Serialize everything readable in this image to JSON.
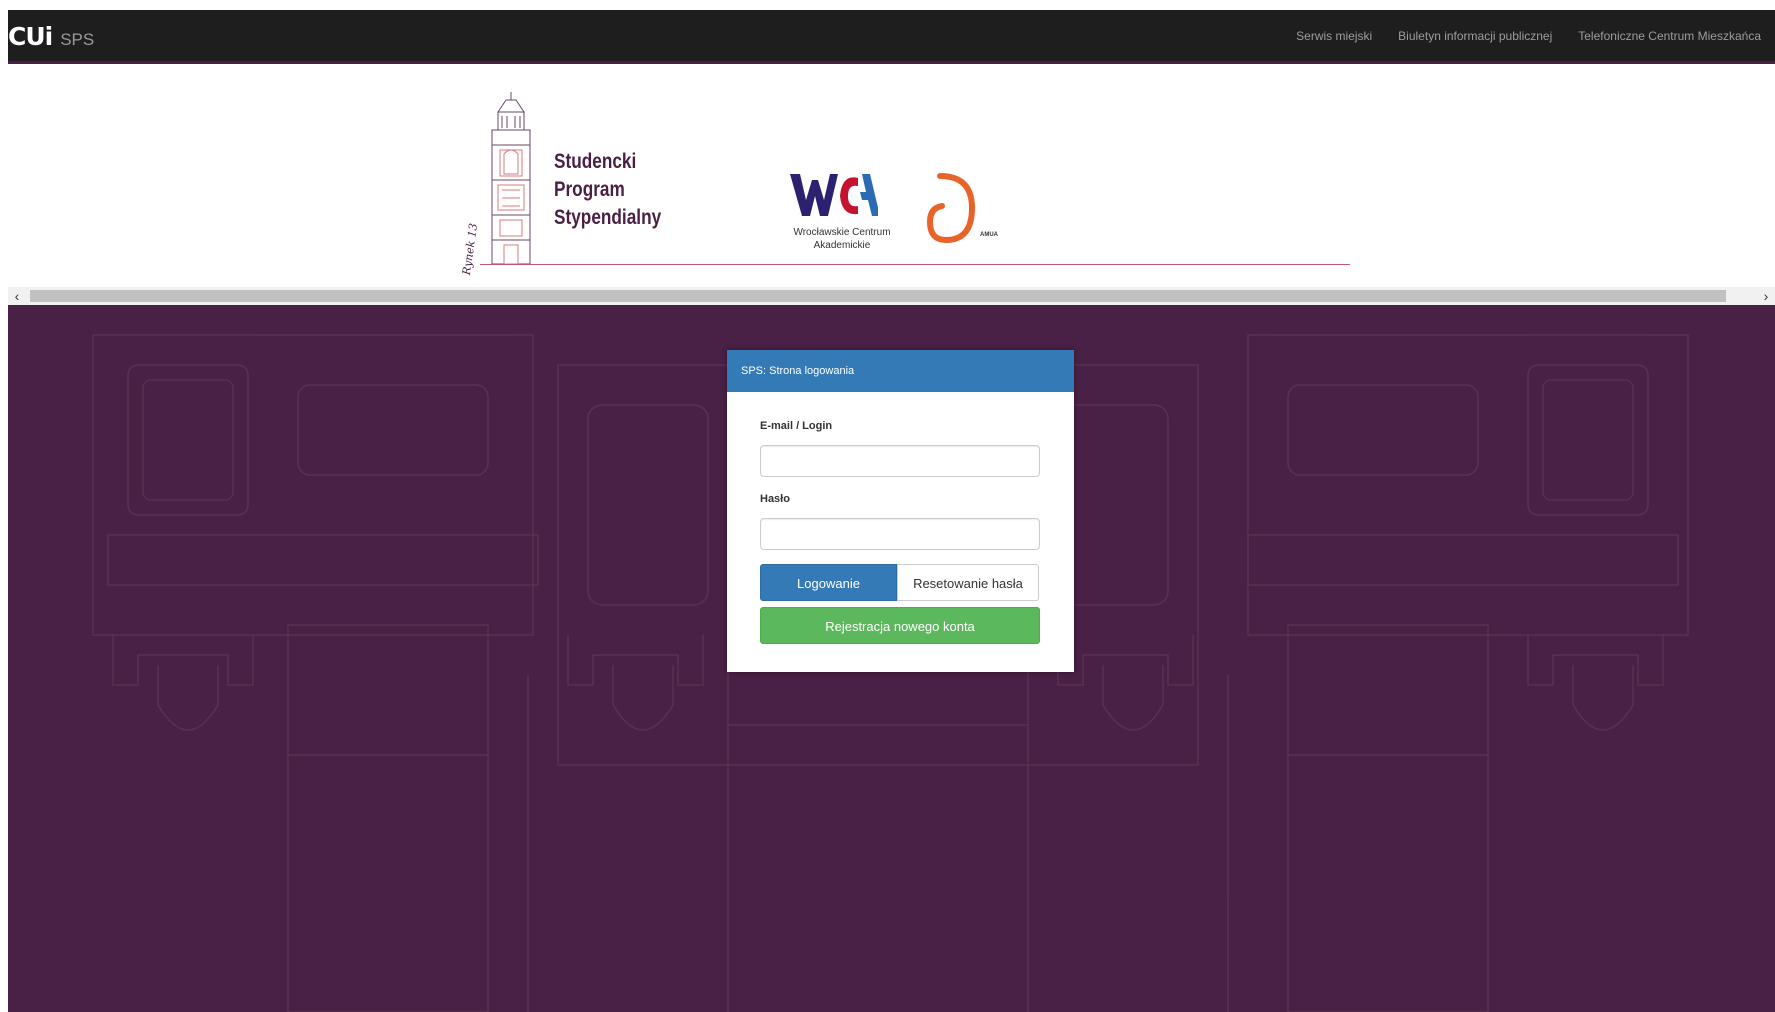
{
  "navbar": {
    "brand_logo": "CUi",
    "brand_sub": "SPS",
    "links": [
      {
        "label": "Serwis miejski"
      },
      {
        "label": "Biuletyn informacji publicznej"
      },
      {
        "label": "Telefoniczne Centrum Mieszkańca"
      }
    ]
  },
  "banner": {
    "program_title_lines": [
      "Studencki",
      "Program",
      "Stypendialny"
    ],
    "signature": "Rynek 13",
    "wca_caption": "Wrocławskie Centrum Akademickie",
    "partner_logo_text": "AMUA"
  },
  "scrollbar": {
    "left_arrow": "‹",
    "right_arrow": "›"
  },
  "login": {
    "heading": "SPS: Strona logowania",
    "email_label": "E-mail / Login",
    "email_value": "",
    "password_label": "Hasło",
    "password_value": "",
    "login_button": "Logowanie",
    "reset_button": "Resetowanie hasła",
    "register_button": "Rejestracja nowego konta"
  },
  "colors": {
    "navbar_bg": "#1e1e1e",
    "brand_purple": "#4a2146",
    "primary_blue": "#337ab7",
    "success_green": "#5cb85c"
  }
}
